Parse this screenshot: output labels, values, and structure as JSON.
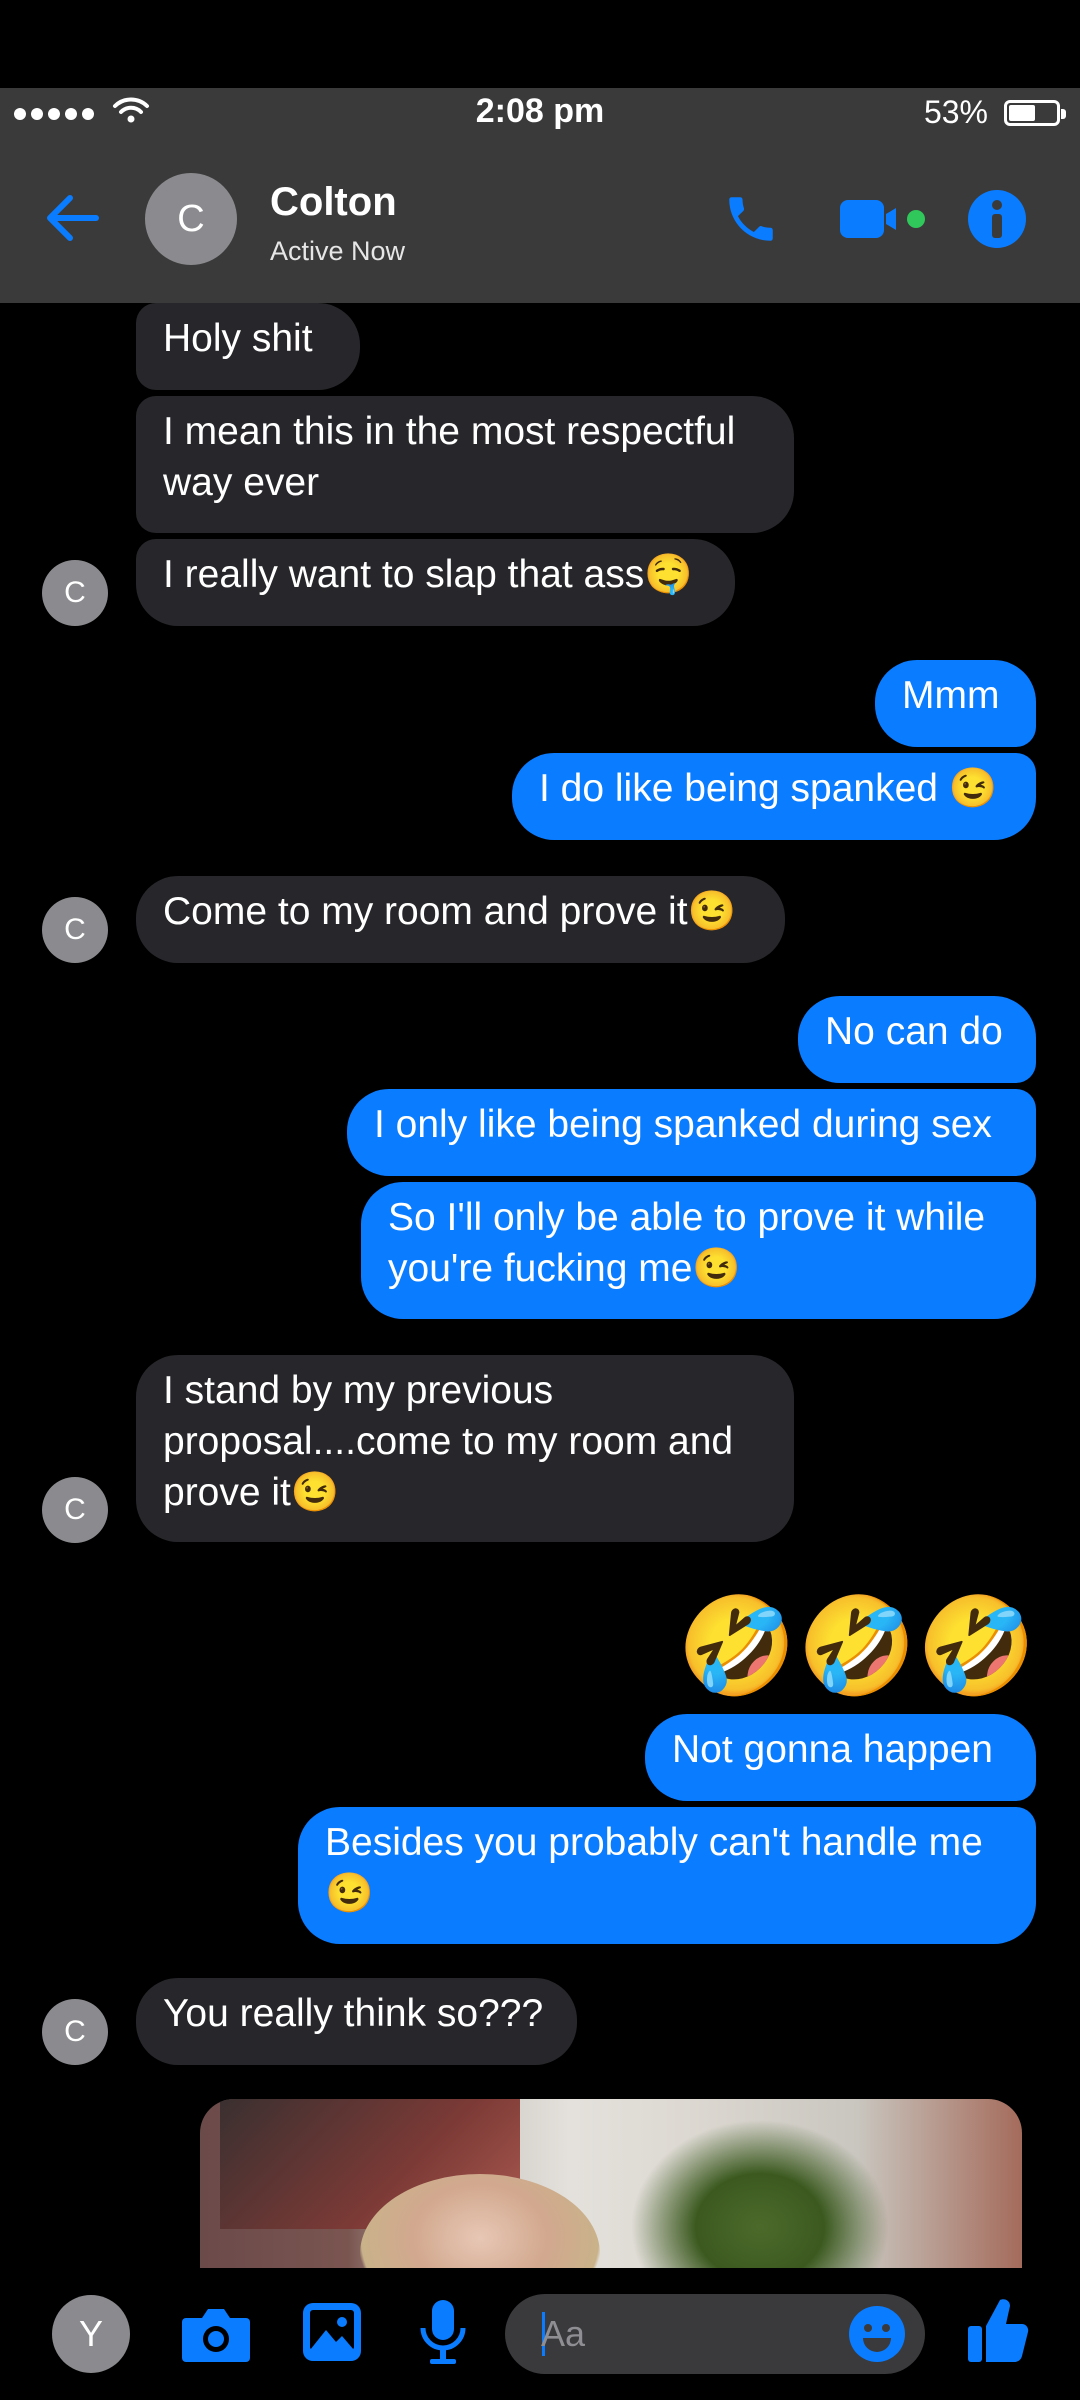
{
  "status_bar": {
    "time": "2:08 pm",
    "battery": "53%",
    "battery_level": 0.53
  },
  "header": {
    "contact_name": "Colton",
    "contact_status": "Active Now",
    "avatar_initial": "C",
    "icons": [
      "back-arrow-icon",
      "phone-icon",
      "video-camera-icon",
      "info-icon"
    ]
  },
  "messages": [
    {
      "from": "them",
      "text": "Holy shit"
    },
    {
      "from": "them",
      "text": "I mean this in the most respectful way ever"
    },
    {
      "from": "them",
      "text": "I really want to slap that ass🤤"
    },
    {
      "from": "me",
      "text": "Mmm"
    },
    {
      "from": "me",
      "text": "I do like being spanked 😉"
    },
    {
      "from": "them",
      "text": "Come to my room and prove it😉"
    },
    {
      "from": "me",
      "text": "No can do"
    },
    {
      "from": "me",
      "text": "I only like being spanked during sex"
    },
    {
      "from": "me",
      "text": "So I'll only be able to prove it while you're fucking me😉"
    },
    {
      "from": "them",
      "text": "I stand by my previous proposal....come to my room and prove it😉"
    },
    {
      "from": "me",
      "text": "🤣🤣🤣"
    },
    {
      "from": "me",
      "text": "Not gonna happen"
    },
    {
      "from": "me",
      "text": "Besides you probably can't handle me 😉"
    },
    {
      "from": "them",
      "text": "You really think so???"
    }
  ],
  "thread_avatar_initial": "C",
  "composer": {
    "user_initial": "Y",
    "placeholder": "Aa",
    "icons": [
      "camera-icon",
      "gallery-icon",
      "microphone-icon",
      "emoji-icon",
      "thumbs-up-icon"
    ]
  },
  "colors": {
    "accent": "#0a7cff",
    "incoming_bubble": "#27272b",
    "header_bg": "#3a3a3a",
    "active_dot": "#30c85a"
  }
}
